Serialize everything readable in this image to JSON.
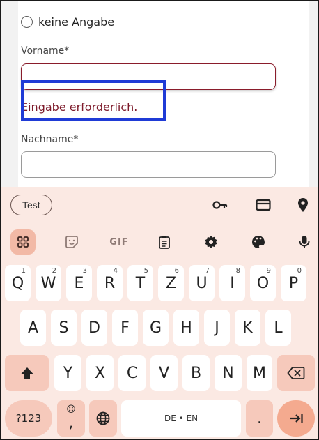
{
  "form": {
    "radio_label": "keine Angabe",
    "first_name_label": "Vorname*",
    "first_name_value": "",
    "error_message": "Eingabe erforderlich.",
    "last_name_label": "Nachname*",
    "last_name_value": ""
  },
  "keyboard": {
    "suggestion_chip": "Test",
    "gif_label": "GIF",
    "row1": [
      {
        "key": "Q",
        "hint": "1"
      },
      {
        "key": "W",
        "hint": "2"
      },
      {
        "key": "E",
        "hint": "3"
      },
      {
        "key": "R",
        "hint": "4"
      },
      {
        "key": "T",
        "hint": "5"
      },
      {
        "key": "Z",
        "hint": "6"
      },
      {
        "key": "U",
        "hint": "7"
      },
      {
        "key": "I",
        "hint": "8"
      },
      {
        "key": "O",
        "hint": "9"
      },
      {
        "key": "P",
        "hint": "0"
      }
    ],
    "row2": [
      "A",
      "S",
      "D",
      "F",
      "G",
      "H",
      "J",
      "K",
      "L"
    ],
    "row3": [
      "Y",
      "X",
      "C",
      "V",
      "B",
      "N",
      "M"
    ],
    "symbols_key": "?123",
    "comma_key": ",",
    "space_label": "DE • EN",
    "period_key": "."
  },
  "colors": {
    "error": "#7d1a2a",
    "highlight": "#1f3bd6",
    "keyboard_bg": "#fbe9e3",
    "action_key": "#f4aa8f"
  }
}
